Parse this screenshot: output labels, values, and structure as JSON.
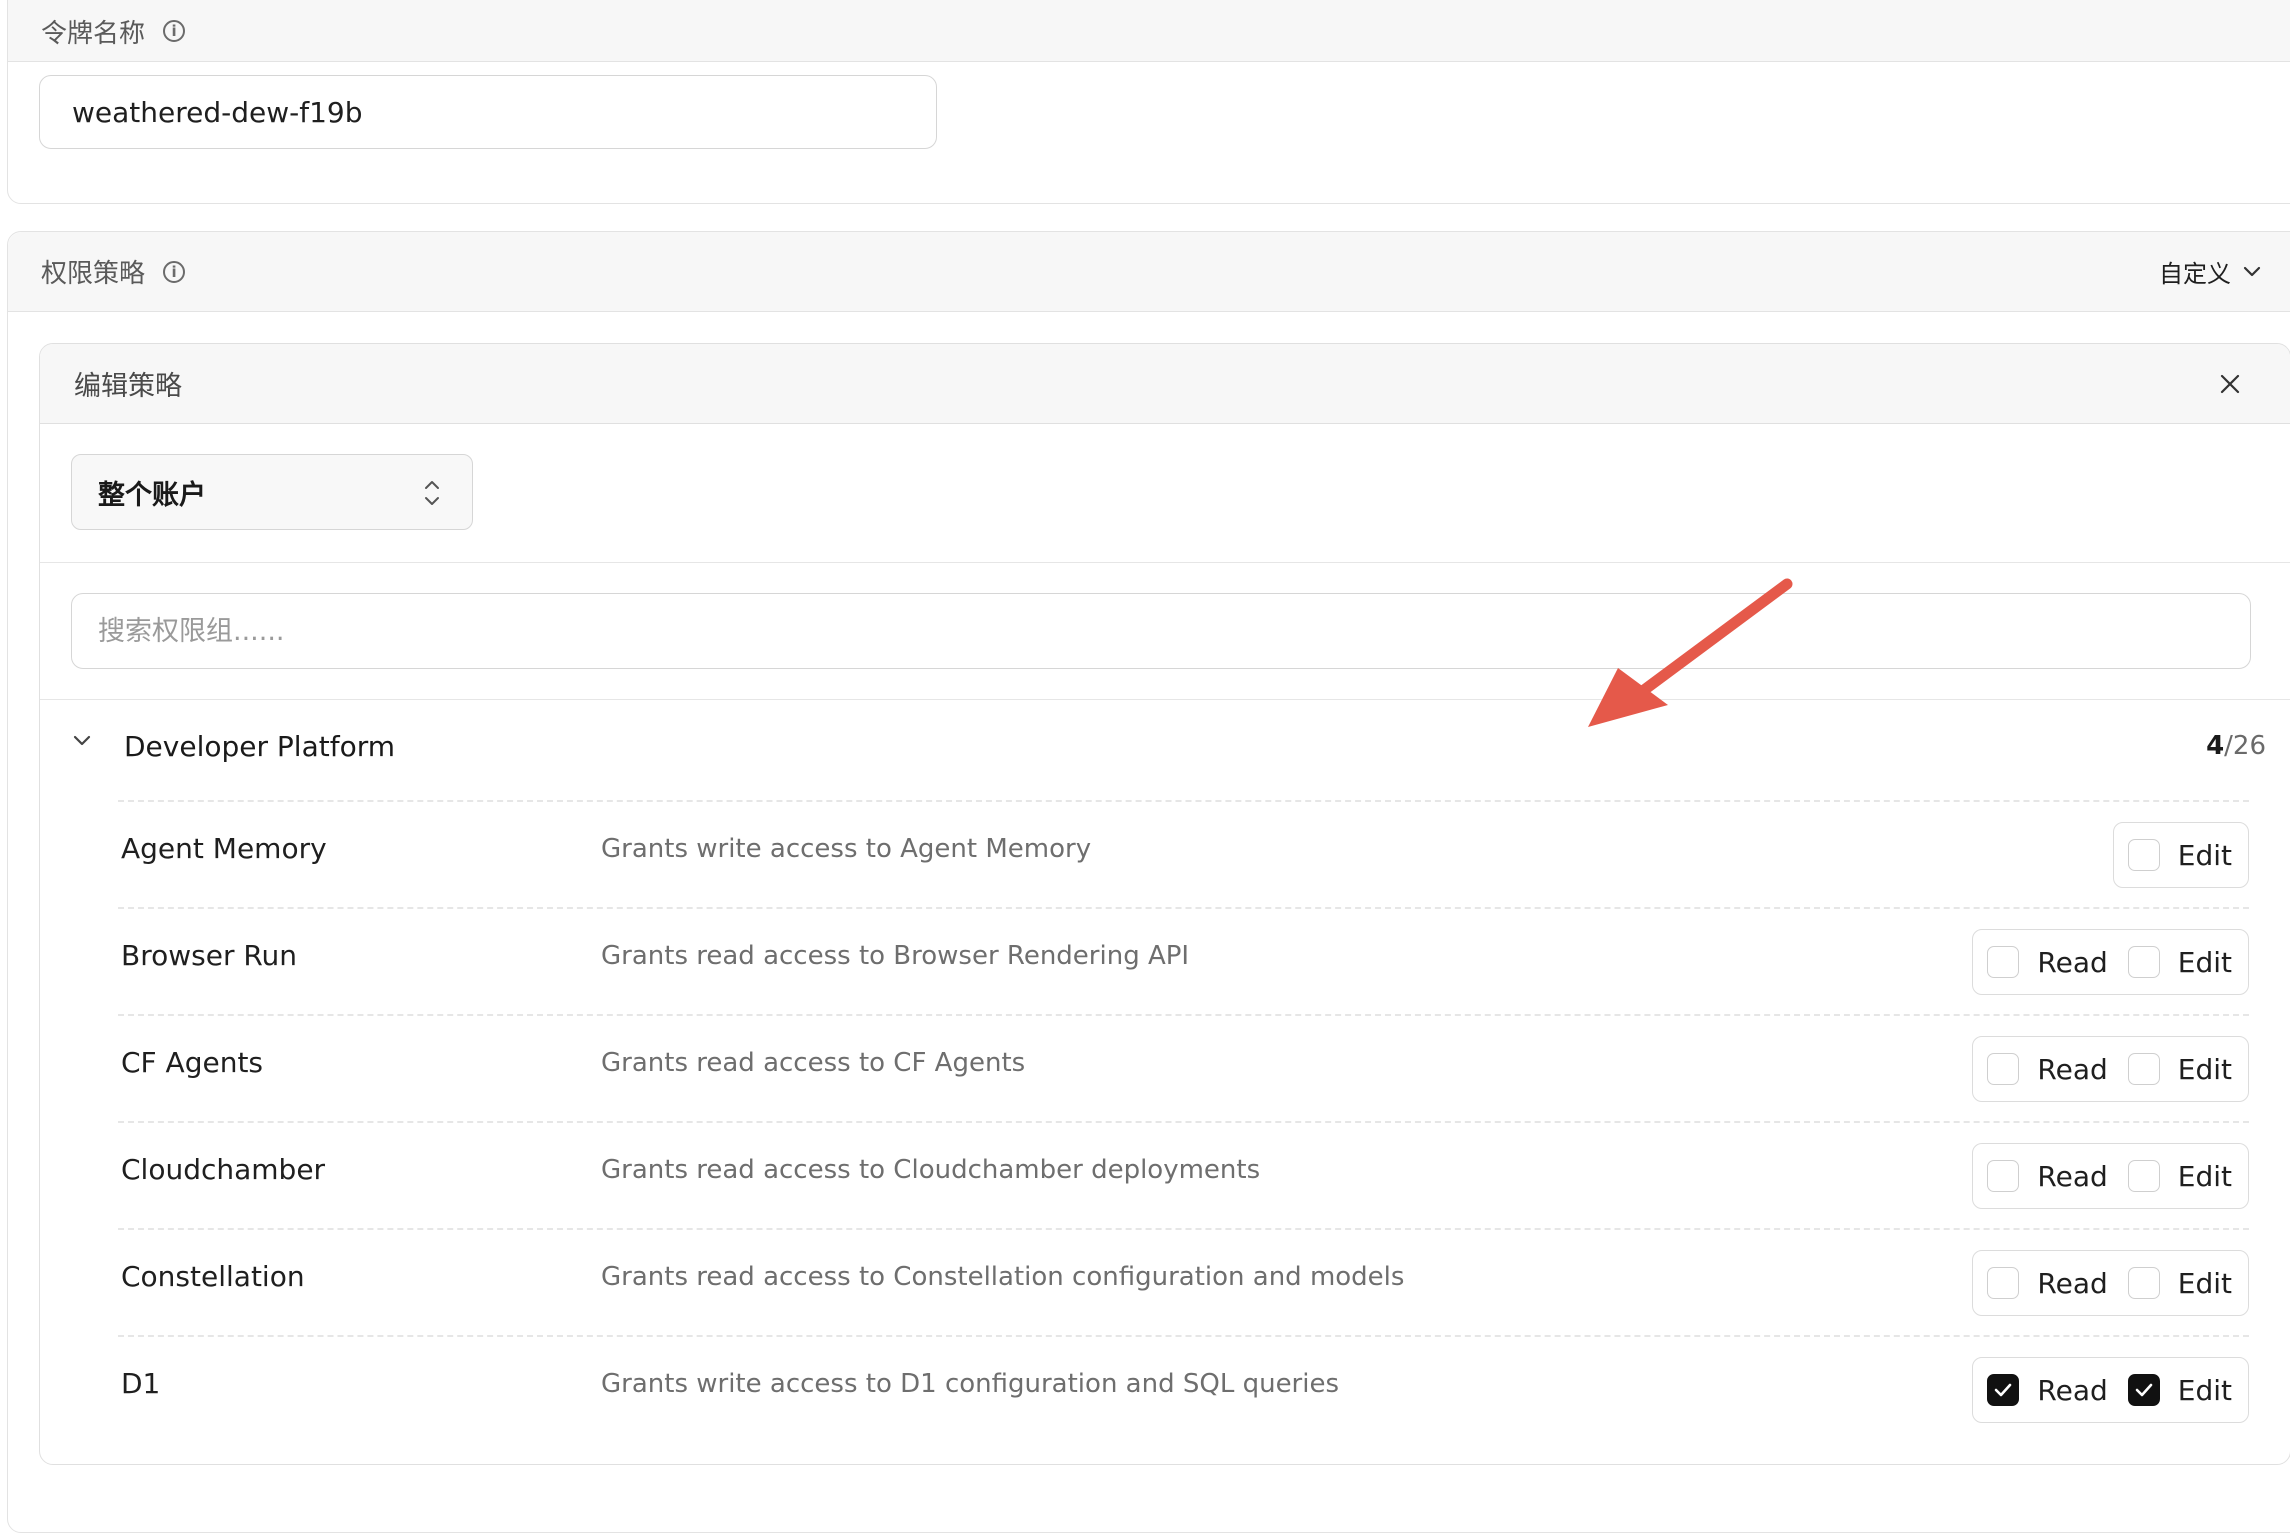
{
  "token_name": {
    "label": "令牌名称",
    "value": "weathered-dew-f19b"
  },
  "permission_policy": {
    "label": "权限策略",
    "mode": "自定义"
  },
  "edit_policy": {
    "title": "编辑策略",
    "scope": "整个账户",
    "search_placeholder": "搜索权限组......"
  },
  "group": {
    "title": "Developer Platform",
    "count_selected": "4",
    "count_total": "/26"
  },
  "permissions": [
    {
      "name": "Agent Memory",
      "desc": "Grants write access to Agent Memory",
      "read": null,
      "edit": false
    },
    {
      "name": "Browser Run",
      "desc": "Grants read access to Browser Rendering API",
      "read": false,
      "edit": false
    },
    {
      "name": "CF Agents",
      "desc": "Grants read access to CF Agents",
      "read": false,
      "edit": false
    },
    {
      "name": "Cloudchamber",
      "desc": "Grants read access to Cloudchamber deployments",
      "read": false,
      "edit": false
    },
    {
      "name": "Constellation",
      "desc": "Grants read access to Constellation configuration and models",
      "read": false,
      "edit": false
    },
    {
      "name": "D1",
      "desc": "Grants write access to D1 configuration and SQL queries",
      "read": true,
      "edit": true
    }
  ],
  "option_labels": {
    "read": "Read",
    "edit": "Edit"
  },
  "colors": {
    "annotation_arrow": "#e5594a",
    "checked": "#111111"
  }
}
